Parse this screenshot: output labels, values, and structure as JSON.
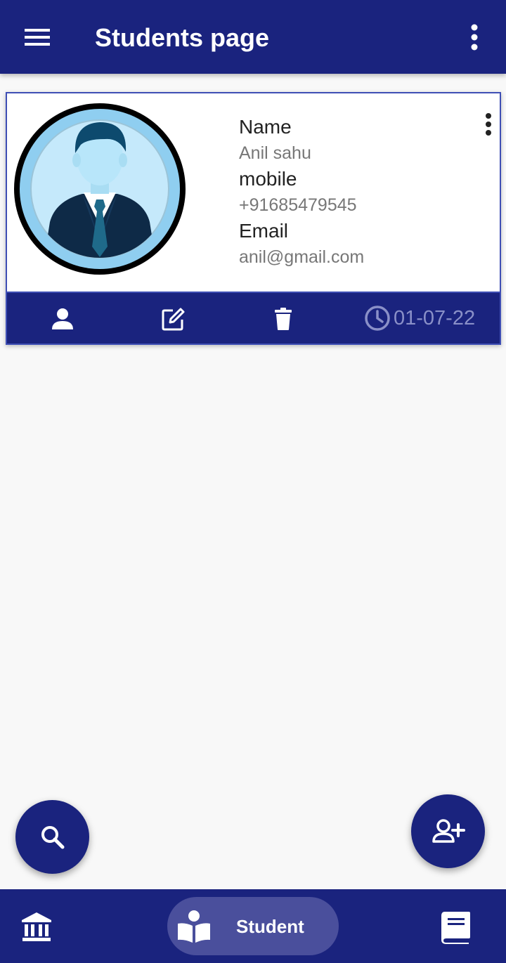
{
  "appbar": {
    "title": "Students page",
    "menu_icon": "hamburger-menu-icon",
    "more_icon": "more-vert-icon"
  },
  "colors": {
    "primary": "#1a237e",
    "card_border": "#3f4fb5",
    "background": "#f8f8f8",
    "nav_active_pill": "#4a4f9c"
  },
  "student_card": {
    "name_label": "Name",
    "name_value": "Anil sahu",
    "mobile_label": "mobile",
    "mobile_value": "+91685479545",
    "email_label": "Email",
    "email_value": "anil@gmail.com",
    "date": "01-07-22",
    "actions": [
      "person-icon",
      "edit-icon",
      "delete-icon"
    ]
  },
  "fabs": {
    "search_icon": "search-icon",
    "add_icon": "person-add-icon"
  },
  "bottom_nav": {
    "items": [
      {
        "icon": "bank-icon"
      },
      {
        "icon": "reading-student-icon",
        "label": "Student",
        "active": true
      },
      {
        "icon": "book-icon"
      }
    ]
  }
}
